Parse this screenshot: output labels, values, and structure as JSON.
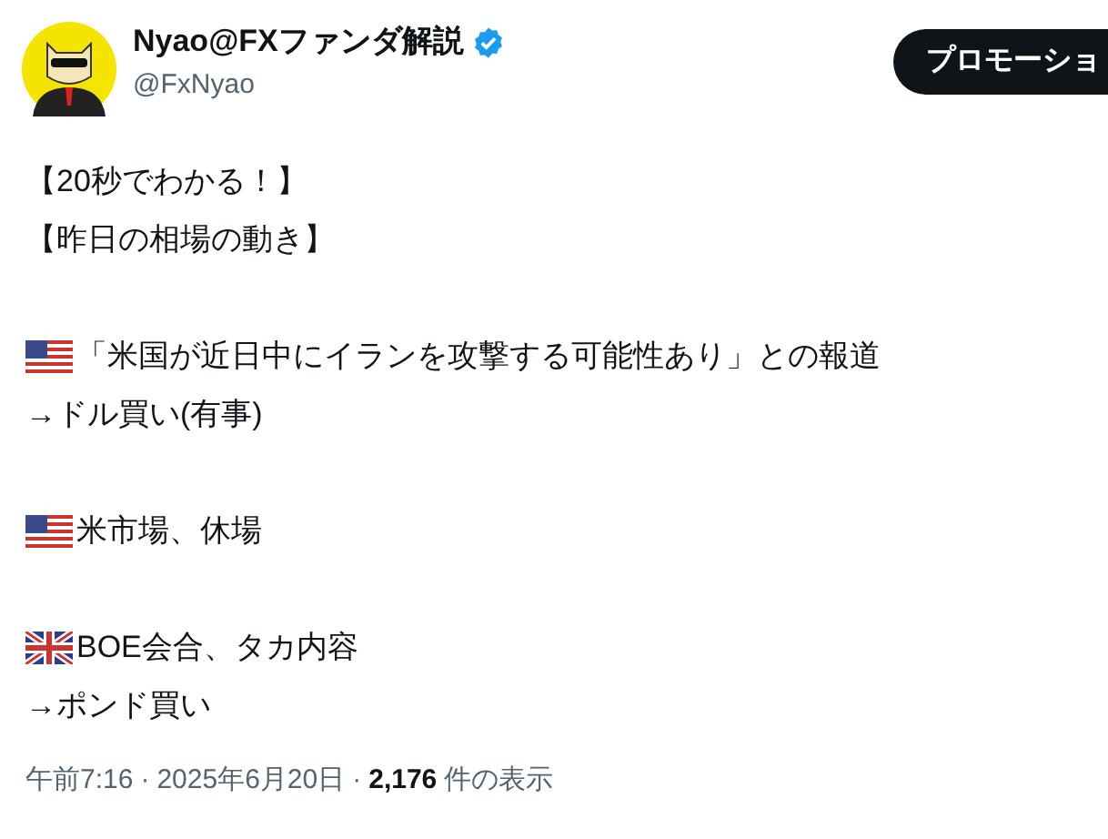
{
  "author": {
    "name": "Nyao@FXファンダ解説",
    "verified": true,
    "handle": "@FxNyao"
  },
  "promo_button": {
    "label": "プロモーショ"
  },
  "body": [
    {
      "kind": "text",
      "text": "【20秒でわかる！】"
    },
    {
      "kind": "text",
      "text": "【昨日の相場の動き】"
    },
    {
      "kind": "blank"
    },
    {
      "kind": "usflag",
      "text": "「米国が近日中にイランを攻撃する可能性あり」との報道"
    },
    {
      "kind": "text",
      "text": "→ドル買い(有事)"
    },
    {
      "kind": "blank"
    },
    {
      "kind": "usflag",
      "text": "米市場、休場"
    },
    {
      "kind": "blank"
    },
    {
      "kind": "ukflag",
      "text": "BOE会合、タカ内容"
    },
    {
      "kind": "text",
      "text": "→ポンド買い"
    }
  ],
  "meta": {
    "time": "午前7:16",
    "separator_1": "·",
    "date": "2025年6月20日",
    "separator_2": "·",
    "views_count": "2,176",
    "views_label": "件の表示"
  }
}
